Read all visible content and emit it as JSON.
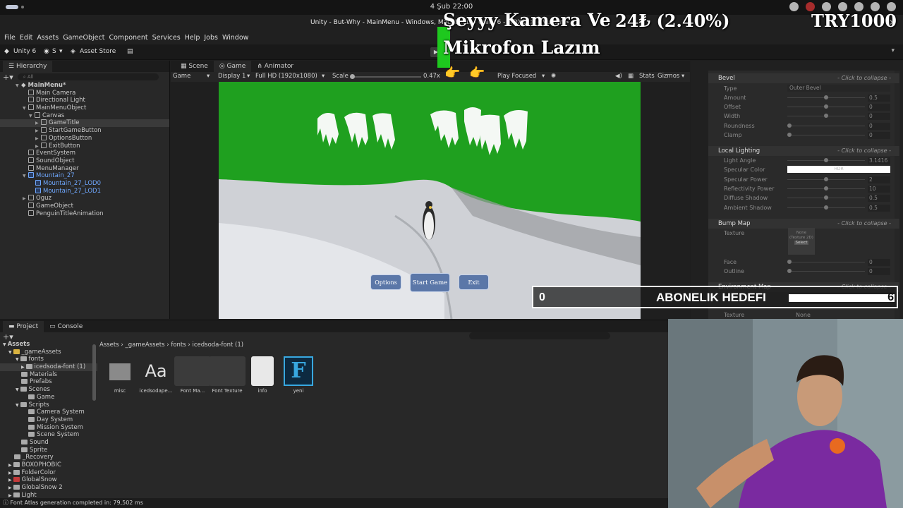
{
  "system": {
    "clock": "4 Şub  22:00"
  },
  "window": {
    "title": "Unity - But-Why - MainMenu - Windows, Mac, Linux - Unity 6 - <DX11> <Vulkan>"
  },
  "menu": [
    "File",
    "Edit",
    "Assets",
    "GameObject",
    "Component",
    "Services",
    "Help",
    "Jobs",
    "Window"
  ],
  "toolbar": {
    "unity_label": "Unity 6",
    "account_label": "S",
    "asset_store": "Asset Store"
  },
  "hierarchy": {
    "tab": "Hierarchy",
    "search_placeholder": "All",
    "items": [
      {
        "label": "MainMenu*",
        "indent": 0
      },
      {
        "label": "Main Camera",
        "indent": 1
      },
      {
        "label": "Directional Light",
        "indent": 1
      },
      {
        "label": "MainMenuObject",
        "indent": 1
      },
      {
        "label": "Canvas",
        "indent": 2
      },
      {
        "label": "GameTitle",
        "indent": 3
      },
      {
        "label": "StartGameButton",
        "indent": 3
      },
      {
        "label": "OptionsButton",
        "indent": 3
      },
      {
        "label": "ExitButton",
        "indent": 3
      },
      {
        "label": "EventSystem",
        "indent": 1
      },
      {
        "label": "SoundObject",
        "indent": 1
      },
      {
        "label": "MenuManager",
        "indent": 1
      },
      {
        "label": "Mountain_27",
        "indent": 1
      },
      {
        "label": "Mountain_27_LOD0",
        "indent": 2
      },
      {
        "label": "Mountain_27_LOD1",
        "indent": 2
      },
      {
        "label": "Oguz",
        "indent": 1
      },
      {
        "label": "GameObject",
        "indent": 1
      },
      {
        "label": "PenguinTitleAnimation",
        "indent": 1
      }
    ]
  },
  "center_tabs": [
    "Scene",
    "Game",
    "Animator"
  ],
  "gamebar": {
    "mode": "Game",
    "display": "Display 1",
    "resolution": "Full HD (1920x1080)",
    "scale_label": "Scale",
    "scale_value": "0.47x",
    "play_focused": "Play Focused",
    "stats": "Stats",
    "gizmos": "Gizmos"
  },
  "game_buttons": {
    "options": "Options",
    "start": "Start Game",
    "exit": "Exit"
  },
  "inspector": {
    "collapse_hint": "- Click to collapse -",
    "bevel": {
      "header": "Bevel",
      "type_label": "Type",
      "type_value": "Outer Bevel",
      "props": [
        {
          "label": "Amount",
          "value": "0.5",
          "level": 0.5
        },
        {
          "label": "Offset",
          "value": "0",
          "level": 0.5
        },
        {
          "label": "Width",
          "value": "0",
          "level": 0.5
        },
        {
          "label": "Roundness",
          "value": "0",
          "level": 0.0
        },
        {
          "label": "Clamp",
          "value": "0",
          "level": 0.0
        }
      ]
    },
    "local_lighting": {
      "header": "Local Lighting",
      "props": [
        {
          "label": "Light Angle",
          "value": "3.1416",
          "level": 0.5
        },
        {
          "label": "Specular Color",
          "value": "HDR",
          "level": null
        },
        {
          "label": "Specular Power",
          "value": "2",
          "level": 0.5
        },
        {
          "label": "Reflectivity Power",
          "value": "10",
          "level": 0.5
        },
        {
          "label": "Diffuse Shadow",
          "value": "0.5",
          "level": 0.5
        },
        {
          "label": "Ambient Shadow",
          "value": "0.5",
          "level": 0.5
        }
      ]
    },
    "bump_map": {
      "header": "Bump Map",
      "texture_label": "Texture",
      "texture_thumb": "None (Texture 2D)",
      "select": "Select",
      "props": [
        {
          "label": "Face",
          "value": "0",
          "level": 0.0
        },
        {
          "label": "Outline",
          "value": "0",
          "level": 0.0
        }
      ]
    },
    "environment_map": {
      "header": "Environment Map",
      "texture_label": "Texture",
      "none": "None"
    }
  },
  "project": {
    "tabs": [
      "Project",
      "Console"
    ],
    "tree": [
      {
        "label": "Assets",
        "indent": 0,
        "color": "none"
      },
      {
        "label": "_gameAssets",
        "indent": 1,
        "color": "yellow"
      },
      {
        "label": "fonts",
        "indent": 2,
        "color": "gray"
      },
      {
        "label": "icedsoda-font (1)",
        "indent": 3,
        "color": "gray"
      },
      {
        "label": "Materials",
        "indent": 2,
        "color": "gray"
      },
      {
        "label": "Prefabs",
        "indent": 2,
        "color": "gray"
      },
      {
        "label": "Scenes",
        "indent": 2,
        "color": "gray"
      },
      {
        "label": "Game",
        "indent": 3,
        "color": "gray"
      },
      {
        "label": "Scripts",
        "indent": 2,
        "color": "gray"
      },
      {
        "label": "Camera System",
        "indent": 3,
        "color": "gray"
      },
      {
        "label": "Day System",
        "indent": 3,
        "color": "gray"
      },
      {
        "label": "Mission System",
        "indent": 3,
        "color": "gray"
      },
      {
        "label": "Scene System",
        "indent": 3,
        "color": "gray"
      },
      {
        "label": "Sound",
        "indent": 2,
        "color": "gray"
      },
      {
        "label": "Sprite",
        "indent": 2,
        "color": "gray"
      },
      {
        "label": "_Recovery",
        "indent": 1,
        "color": "gray"
      },
      {
        "label": "BOXOPHOBIC",
        "indent": 1,
        "color": "gray"
      },
      {
        "label": "FolderColor",
        "indent": 1,
        "color": "gray"
      },
      {
        "label": "GlobalSnow",
        "indent": 1,
        "color": "red"
      },
      {
        "label": "GlobalSnow 2",
        "indent": 1,
        "color": "gray"
      },
      {
        "label": "Light",
        "indent": 1,
        "color": "gray"
      }
    ],
    "breadcrumb": [
      "Assets",
      "_gameAssets",
      "fonts",
      "icedsoda-font (1)"
    ],
    "assets": [
      {
        "label": "misc",
        "kind": "folder"
      },
      {
        "label": "icedsodape...",
        "kind": "font",
        "glyph": "Aa"
      },
      {
        "label": "Font Ma...",
        "kind": "material"
      },
      {
        "label": "Font Texture",
        "kind": "texture"
      },
      {
        "label": "info",
        "kind": "doc"
      },
      {
        "label": "yeni",
        "kind": "fontasset",
        "glyph": "F"
      }
    ]
  },
  "status": "Font Atlas generation completed in: 79,502 ms",
  "overlay": {
    "line1": "Şeyyy Kamera Ve",
    "line2": "Mikrofon Lazım",
    "price": "24₺ (2.40%)",
    "currency": "TRY1000",
    "goal": {
      "start": "0",
      "label": "ABONELIK HEDEFI",
      "end": "6",
      "progress": 0.0
    }
  },
  "colors": {
    "green_screen": "#1fa01f",
    "overlay_green": "#1ec81e",
    "unity_dark": "#282828"
  }
}
